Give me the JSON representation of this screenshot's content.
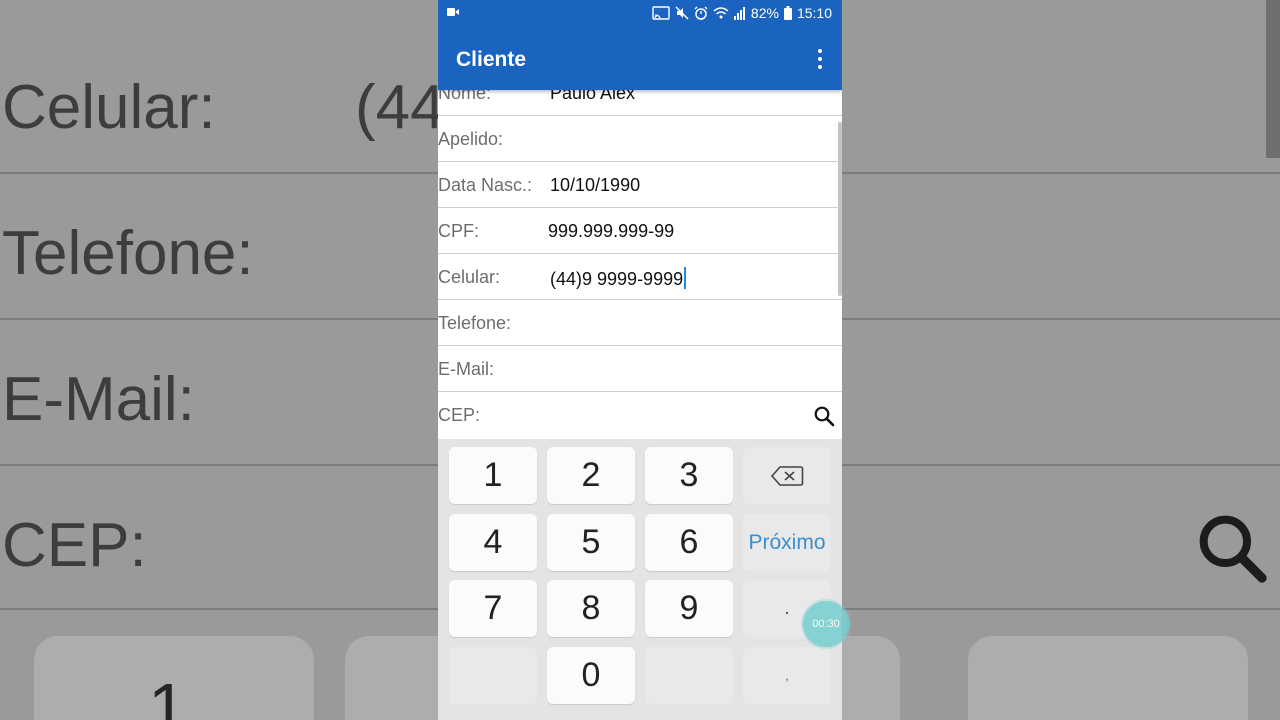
{
  "background": {
    "left_labels": [
      "Celular:",
      "Telefone:",
      "E-Mail:",
      "CEP:"
    ],
    "left_value_fragment": "(44",
    "left_key_label": "1"
  },
  "status_bar": {
    "battery": "82%",
    "time": "15:10"
  },
  "app_bar": {
    "title": "Cliente",
    "menu_icon": "more-vert-icon"
  },
  "form": {
    "fields": [
      {
        "label": "Nome:",
        "value": "Paulo Alex"
      },
      {
        "label": "Apelido:",
        "value": ""
      },
      {
        "label": "Data Nasc.:",
        "value": "10/10/1990"
      },
      {
        "label": "CPF:",
        "value": "999.999.999-99"
      },
      {
        "label": "Celular:",
        "value": "(44)9 9999-9999"
      },
      {
        "label": "Telefone:",
        "value": ""
      },
      {
        "label": "E-Mail:",
        "value": ""
      },
      {
        "label": "CEP:",
        "value": ""
      }
    ],
    "cep_search_icon": "search-icon",
    "accent_color": "#1e88e5"
  },
  "keyboard": {
    "keys": [
      "1",
      "2",
      "3",
      "4",
      "5",
      "6",
      "7",
      "8",
      "9",
      "0"
    ],
    "next_label": "Próximo",
    "dot_label": ".",
    "comma_label": ",",
    "backspace_icon": "backspace-icon"
  },
  "recording_timer": "00:30",
  "colors": {
    "app_bar": "#1a64bf",
    "keyboard_bg": "#e4e4e4",
    "next_key_text": "#3a8fd0"
  }
}
